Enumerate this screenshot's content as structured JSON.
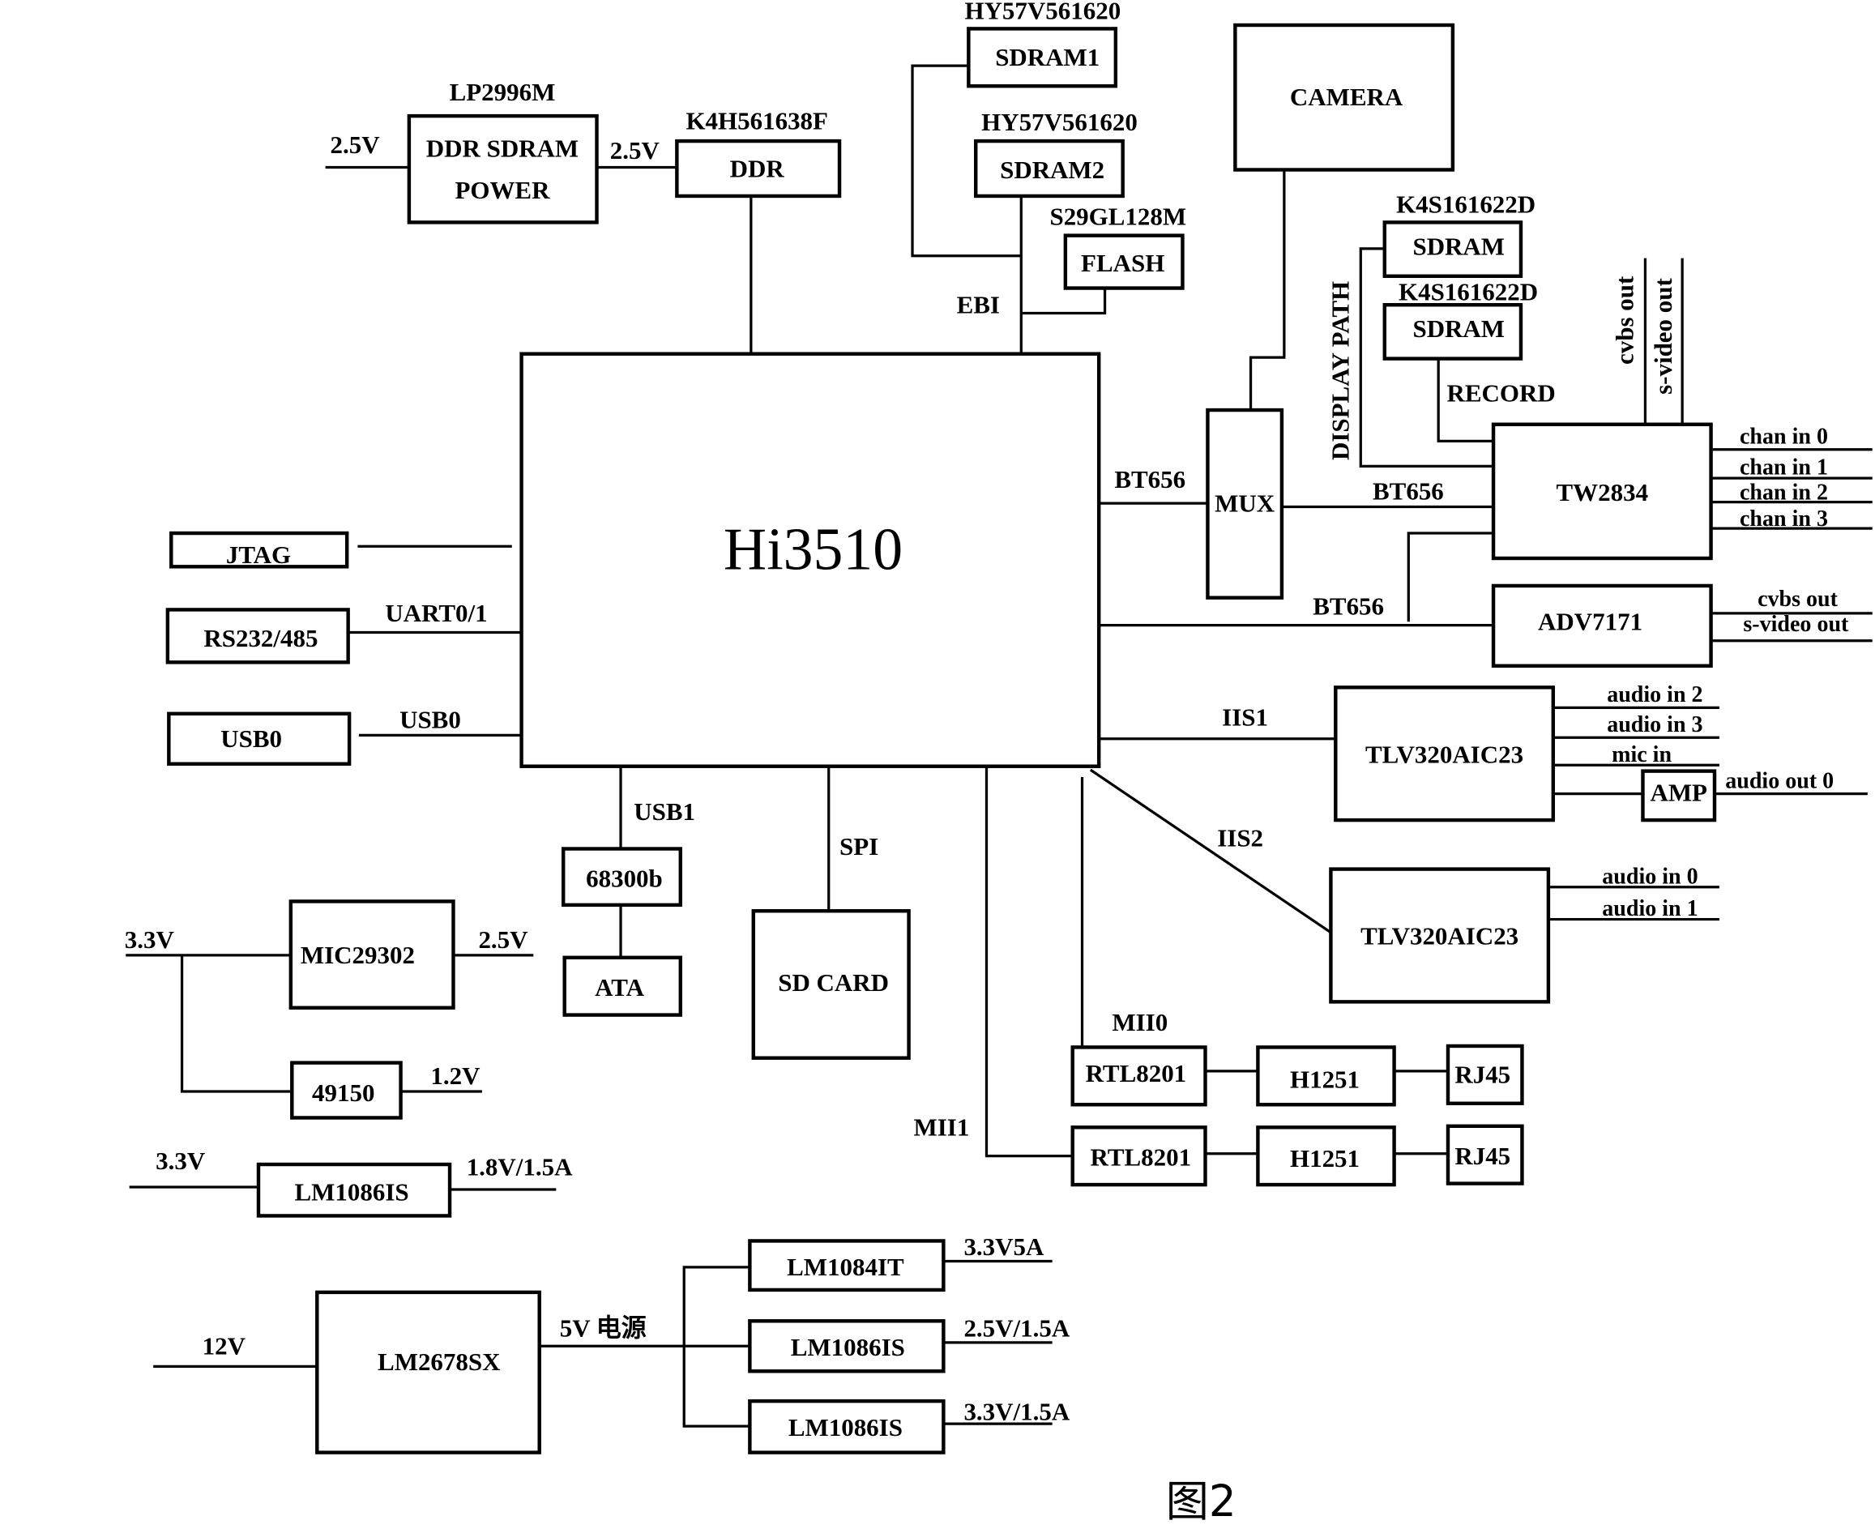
{
  "figure_caption": "图2",
  "main_chip": "Hi3510",
  "blocks": {
    "ddr_power": {
      "part": "LP2996M",
      "line1": "DDR  SDRAM",
      "line2": "POWER",
      "in": "2.5V",
      "out": "2.5V"
    },
    "ddr": {
      "part": "K4H561638F",
      "label": "DDR"
    },
    "sdram1": {
      "part": "HY57V561620",
      "label": "SDRAM1"
    },
    "sdram2": {
      "part": "HY57V561620",
      "label": "SDRAM2"
    },
    "flash": {
      "part": "S29GL128M",
      "label": "FLASH"
    },
    "ebi": "EBI",
    "camera": "CAMERA",
    "display_sdram": {
      "part": "K4S161622D",
      "label": "SDRAM"
    },
    "record_sdram": {
      "part": "K4S161622D",
      "label": "SDRAM"
    },
    "display_path": "DISPLAY PATH",
    "record": "RECORD",
    "mux": "MUX",
    "bt656_a": "BT656",
    "bt656_b": "BT656",
    "bt656_c": "BT656",
    "tw2834": {
      "label": "TW2834",
      "inputs": [
        "chan in  0",
        "chan in  1",
        "chan in  2",
        "chan in  3"
      ],
      "outputs": [
        "cvbs out",
        "s-video out"
      ]
    },
    "adv7171": {
      "label": "ADV7171",
      "outputs": [
        "cvbs out",
        "s-video out"
      ]
    },
    "codec1": {
      "bus": "IIS1",
      "label": "TLV320AIC23",
      "inputs": [
        "audio in  2",
        "audio in  3",
        "mic in"
      ],
      "amp": "AMP",
      "output": "audio out  0"
    },
    "codec2": {
      "bus": "IIS2",
      "label": "TLV320AIC23",
      "inputs": [
        "audio in  0",
        "audio in  1"
      ]
    },
    "jtag": "JTAG",
    "rs232": {
      "label": "RS232/485",
      "bus": "UART0/1"
    },
    "usb0": {
      "label": "USB0",
      "bus": "USB0"
    },
    "usb1": {
      "bus": "USB1",
      "bridge": "68300b",
      "ata": "ATA"
    },
    "sd": {
      "bus": "SPI",
      "label": "SD CARD"
    },
    "eth0": {
      "bus": "MII0",
      "phy": "RTL8201",
      "mag": "H1251",
      "jack": "RJ45"
    },
    "eth1": {
      "bus": "MII1",
      "phy": "RTL8201",
      "mag": "H1251",
      "jack": "RJ45"
    },
    "mic29302": {
      "label": "MIC29302",
      "in": "3.3V",
      "out": "2.5V"
    },
    "reg49150": {
      "label": "49150",
      "out": "1.2V"
    },
    "lm1086_a": {
      "label": "LM1086IS",
      "in": "3.3V",
      "out": "1.8V/1.5A"
    },
    "lm2678": {
      "label": "LM2678SX",
      "in": "12V",
      "out": "5V 电源"
    },
    "lm1084": {
      "label": "LM1084IT",
      "out": "3.3V5A"
    },
    "lm1086_b": {
      "label": "LM1086IS",
      "out": "2.5V/1.5A"
    },
    "lm1086_c": {
      "label": "LM1086IS",
      "out": "3.3V/1.5A"
    }
  }
}
